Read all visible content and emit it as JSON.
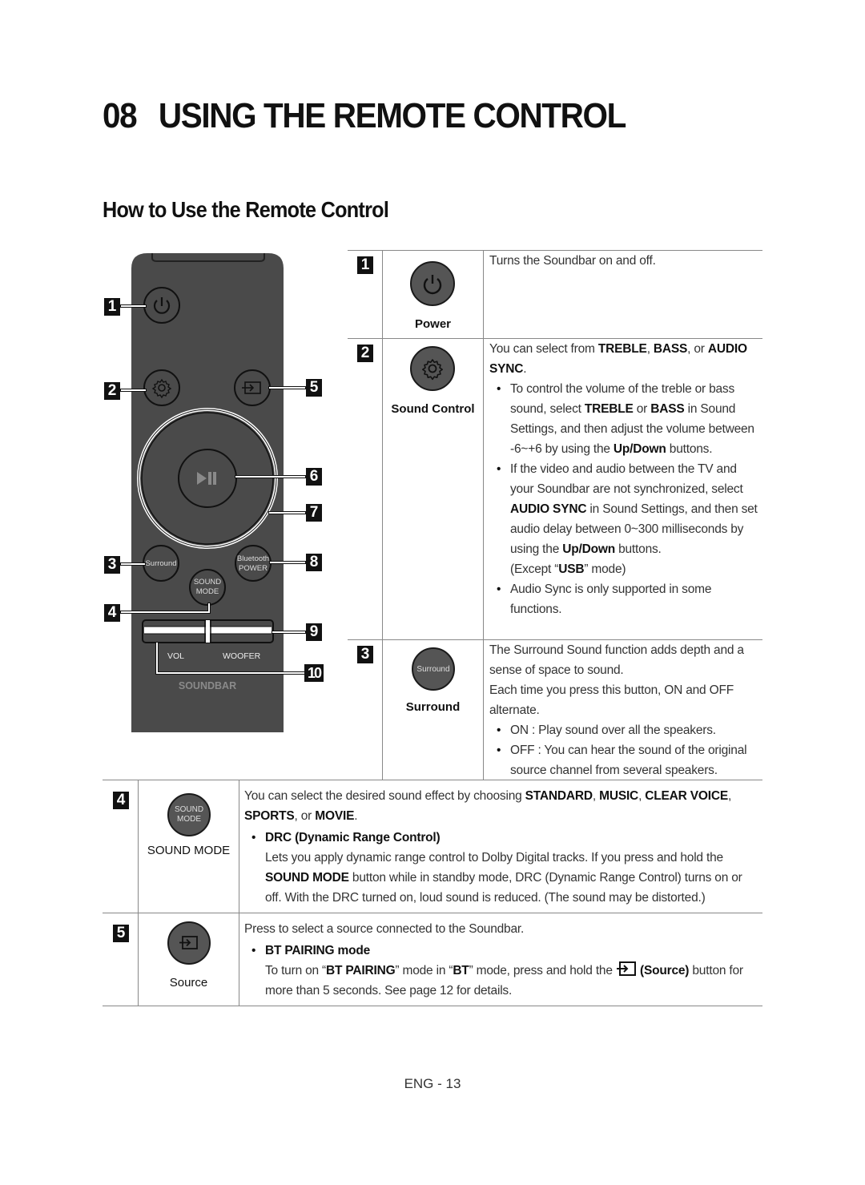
{
  "chapter": {
    "number": "08",
    "title": "USING THE REMOTE CONTROL"
  },
  "section_title": "How to Use the Remote Control",
  "remote": {
    "callouts": [
      "1",
      "2",
      "3",
      "4",
      "5",
      "6",
      "7",
      "8",
      "9",
      "10"
    ],
    "buttons": {
      "surround": "Surround",
      "bluetooth_line1": "Bluetooth",
      "bluetooth_line2": "POWER",
      "sound_mode_line1": "SOUND",
      "sound_mode_line2": "MODE",
      "vol": "VOL",
      "woofer": "WOOFER"
    },
    "brand": "SOUNDBAR",
    "colors": {
      "body": "#4a4a4a",
      "outline": "#1a1a1a"
    }
  },
  "table": {
    "rows": [
      {
        "num": "1",
        "icon": "power-icon",
        "label": "Power",
        "intro_html": "Turns the Soundbar on and off."
      },
      {
        "num": "2",
        "icon": "gear-icon",
        "label": "Sound Control",
        "intro_html": "You can select from <b>TREBLE</b>, <b>BASS</b>, or <b>AUDIO SYNC</b>.",
        "bullets": [
          "To control the volume of the treble or bass sound, select <b>TREBLE</b> or <b>BASS</b> in Sound Settings, and then adjust the volume between -6~+6 by using the <b>Up/Down</b> buttons.",
          "If the video and audio between the TV and your Soundbar are not synchronized, select <b>AUDIO SYNC</b> in Sound Settings, and then set audio delay between 0~300 milliseconds by using the <b>Up/Down</b> buttons.<br>(Except “<b>USB</b>” mode)",
          "Audio Sync is only supported in some functions."
        ]
      },
      {
        "num": "3",
        "icon_text": "Surround",
        "label": "Surround",
        "intro_html": "The Surround Sound function adds depth and a sense of space to sound.<br>Each time you press this button, ON and OFF alternate.",
        "bullets": [
          "ON : Play sound over all the speakers.",
          "OFF : You can hear the sound of the original source channel from several speakers."
        ]
      },
      {
        "num": "4",
        "icon_text_1": "SOUND",
        "icon_text_2": "MODE",
        "label": "SOUND MODE",
        "intro_html": "You can select the desired sound effect by choosing <b>STANDARD</b>, <b>MUSIC</b>, <b>CLEAR VOICE</b>, <b>SPORTS</b>, or <b>MOVIE</b>.",
        "bullet_title": "DRC (Dynamic Range Control)",
        "bullet_body_html": "Lets you apply dynamic range control to Dolby Digital tracks. If you press and hold the <b>SOUND MODE</b> button while in standby mode, DRC (Dynamic Range Control) turns on or off. With the DRC turned on, loud sound is reduced. (The sound may be distorted.)"
      },
      {
        "num": "5",
        "icon": "source-icon",
        "label": "Source",
        "intro_html": "Press to select a source connected to the Soundbar.",
        "bullet_title": "BT PAIRING mode",
        "bullet_body_pre_html": "To turn on “<b>BT PAIRING</b>” mode in “<b>BT</b>” mode, press and hold the",
        "bullet_body_post_html": "<b>(Source)</b> button for more than 5 seconds. See page 12 for details."
      }
    ]
  },
  "footer": {
    "page_label": "ENG - 13"
  }
}
